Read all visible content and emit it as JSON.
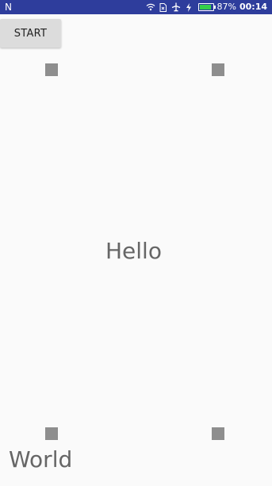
{
  "status_bar": {
    "carrier_label": "N",
    "battery_percent_text": "87%",
    "battery_level": 0.87,
    "time": "00:14",
    "icons": [
      "wifi-icon",
      "sim-card-icon",
      "airplane-icon",
      "charging-bolt-icon",
      "battery-icon"
    ],
    "colors": {
      "background": "#2e3d9c",
      "battery_fill": "#35d04a"
    }
  },
  "toolbar": {
    "start_label": "START"
  },
  "canvas": {
    "markers": [
      "square-marker",
      "square-marker",
      "square-marker",
      "square-marker"
    ],
    "hello_text": "Hello",
    "world_text": "World"
  }
}
